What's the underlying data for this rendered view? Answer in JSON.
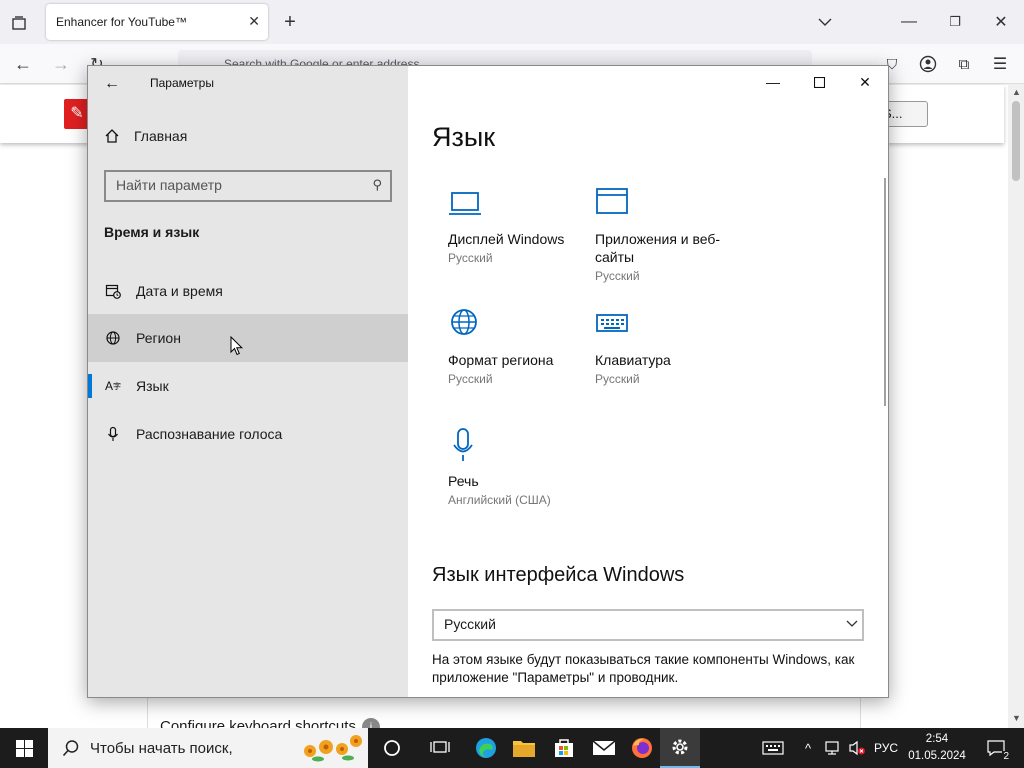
{
  "firefox": {
    "tab_title": "Enhancer for YouTube™",
    "url_placeholder": "Search with Google or enter address",
    "select_value": "S...",
    "card_text": "Configure keyboard shortcuts"
  },
  "settings": {
    "app_title": "Параметры",
    "home_label": "Главная",
    "search_placeholder": "Найти параметр",
    "section_title": "Время и язык",
    "nav_items": [
      {
        "label": "Дата и время",
        "icon": "calendar-clock-icon"
      },
      {
        "label": "Регион",
        "icon": "globe-region-icon"
      },
      {
        "label": "Язык",
        "icon": "language-icon"
      },
      {
        "label": "Распознавание голоса",
        "icon": "microphone-icon"
      }
    ],
    "page_title": "Язык",
    "tiles": [
      {
        "name": "Дисплей Windows",
        "sub": "Русский",
        "icon": "laptop-icon"
      },
      {
        "name": "Приложения и веб-сайты",
        "sub": "Русский",
        "icon": "window-icon"
      },
      {
        "name": "Формат региона",
        "sub": "Русский",
        "icon": "globe-icon"
      },
      {
        "name": "Клавиатура",
        "sub": "Русский",
        "icon": "keyboard-icon"
      },
      {
        "name": "Речь",
        "sub": "Английский (США)",
        "icon": "microphone-icon"
      }
    ],
    "interface_title": "Язык интерфейса Windows",
    "interface_value": "Русский",
    "interface_desc": "На этом языке будут показываться такие компоненты Windows, как приложение \"Параметры\" и проводник."
  },
  "taskbar": {
    "search_placeholder": "Чтобы начать поиск,",
    "lang": "РУС",
    "time": "2:54",
    "date": "01.05.2024",
    "notifications": "2"
  },
  "colors": {
    "accent": "#0078d7",
    "icon_blue": "#0067c0",
    "sidebar_bg": "#e6e6e6",
    "taskbar_bg": "#1c1c1c"
  }
}
